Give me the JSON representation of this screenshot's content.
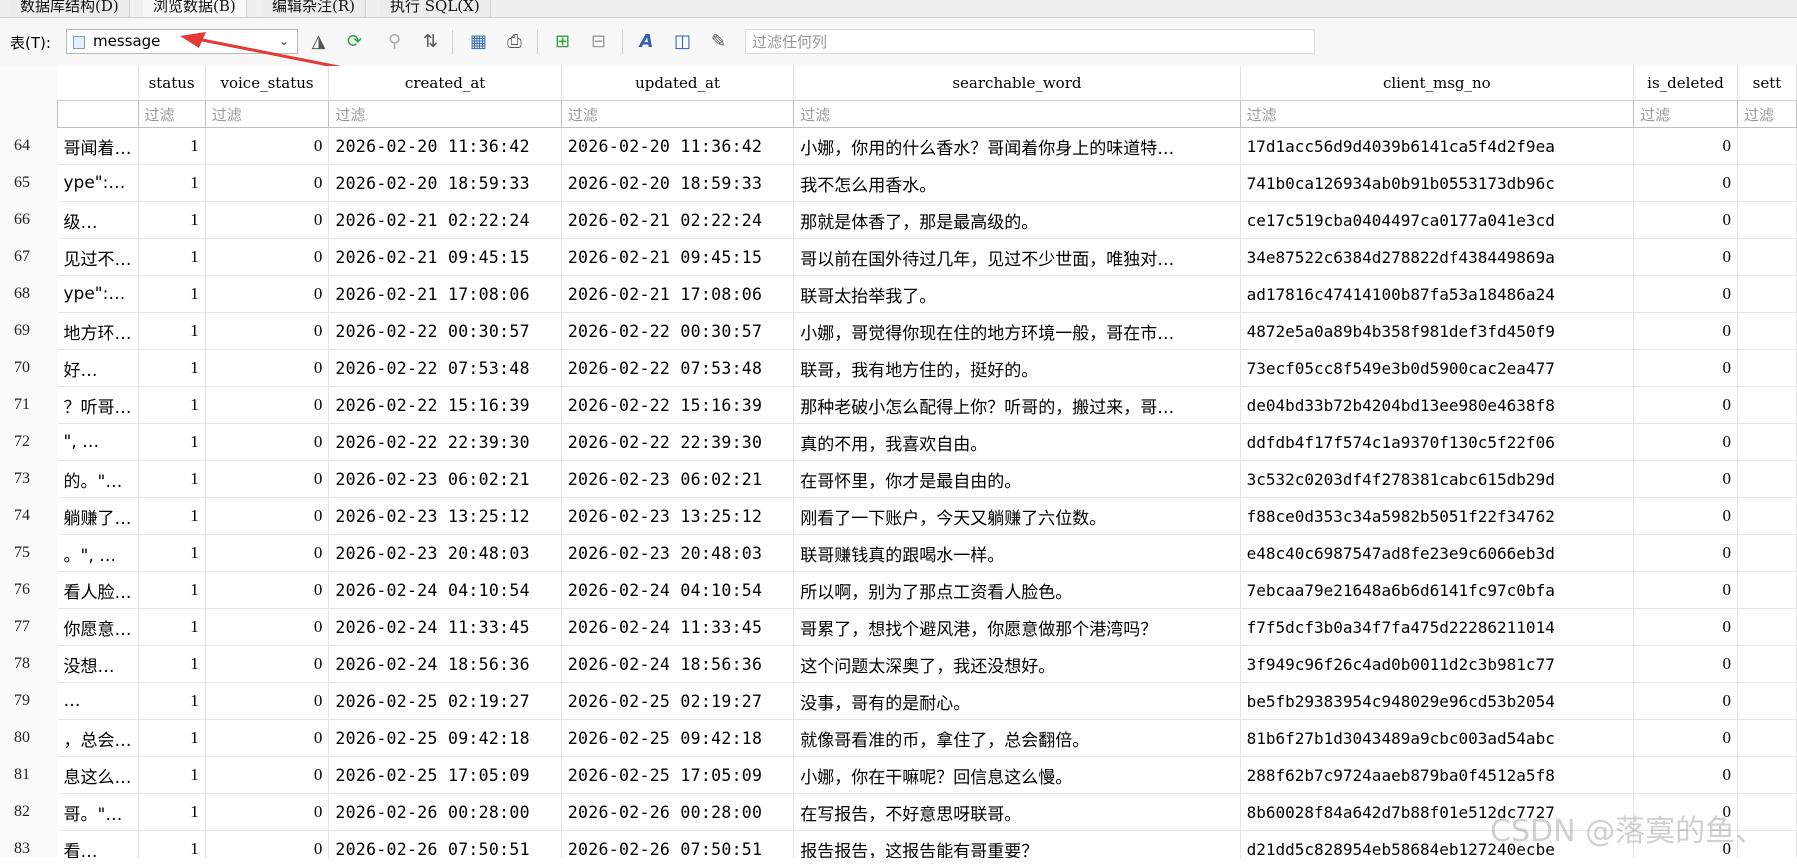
{
  "tabs": [
    "数据库结构(D)",
    "浏览数据(B)",
    "编辑杂注(R)",
    "执行 SQL(X)"
  ],
  "toolbar": {
    "table_label": "表(T):",
    "table_value": "message",
    "filter_placeholder": "过滤任何列"
  },
  "grid": {
    "columns": [
      "",
      "status",
      "voice_status",
      "created_at",
      "updated_at",
      "searchable_word",
      "client_msg_no",
      "is_deleted",
      "sett"
    ],
    "filter_placeholder": "过滤",
    "rows": [
      {
        "n": "64",
        "c0": "哥闻着…",
        "status": "1",
        "voice": "0",
        "created": "2026-02-20 11:36:42",
        "updated": "2026-02-20 11:36:42",
        "word": "小娜，你用的什么香水？哥闻着你身上的味道特…",
        "cmn": "17d1acc56d9d4039b6141ca5f4d2f9ea",
        "del": "0"
      },
      {
        "n": "65",
        "c0": "ype\":…",
        "status": "1",
        "voice": "0",
        "created": "2026-02-20 18:59:33",
        "updated": "2026-02-20 18:59:33",
        "word": "我不怎么用香水。",
        "cmn": "741b0ca126934ab0b91b0553173db96c",
        "del": "0"
      },
      {
        "n": "66",
        "c0": "级…",
        "status": "1",
        "voice": "0",
        "created": "2026-02-21 02:22:24",
        "updated": "2026-02-21 02:22:24",
        "word": "那就是体香了，那是最高级的。",
        "cmn": "ce17c519cba0404497ca0177a041e3cd",
        "del": "0"
      },
      {
        "n": "67",
        "c0": "见过不…",
        "status": "1",
        "voice": "0",
        "created": "2026-02-21 09:45:15",
        "updated": "2026-02-21 09:45:15",
        "word": "哥以前在国外待过几年，见过不少世面，唯独对…",
        "cmn": "34e87522c6384d278822df438449869a",
        "del": "0"
      },
      {
        "n": "68",
        "c0": "ype\":…",
        "status": "1",
        "voice": "0",
        "created": "2026-02-21 17:08:06",
        "updated": "2026-02-21 17:08:06",
        "word": "联哥太抬举我了。",
        "cmn": "ad17816c47414100b87fa53a18486a24",
        "del": "0"
      },
      {
        "n": "69",
        "c0": "地方环…",
        "status": "1",
        "voice": "0",
        "created": "2026-02-22 00:30:57",
        "updated": "2026-02-22 00:30:57",
        "word": "小娜，哥觉得你现在住的地方环境一般，哥在市…",
        "cmn": "4872e5a0a89b4b358f981def3fd450f9",
        "del": "0"
      },
      {
        "n": "70",
        "c0": "好…",
        "status": "1",
        "voice": "0",
        "created": "2026-02-22 07:53:48",
        "updated": "2026-02-22 07:53:48",
        "word": "联哥，我有地方住的，挺好的。",
        "cmn": "73ecf05cc8f549e3b0d5900cac2ea477",
        "del": "0"
      },
      {
        "n": "71",
        "c0": "？听哥…",
        "status": "1",
        "voice": "0",
        "created": "2026-02-22 15:16:39",
        "updated": "2026-02-22 15:16:39",
        "word": "那种老破小怎么配得上你？听哥的，搬过来，哥…",
        "cmn": "de04bd33b72b4204bd13ee980e4638f8",
        "del": "0"
      },
      {
        "n": "72",
        "c0": "\", …",
        "status": "1",
        "voice": "0",
        "created": "2026-02-22 22:39:30",
        "updated": "2026-02-22 22:39:30",
        "word": "真的不用，我喜欢自由。",
        "cmn": "ddfdb4f17f574c1a9370f130c5f22f06",
        "del": "0"
      },
      {
        "n": "73",
        "c0": "的。\"…",
        "status": "1",
        "voice": "0",
        "created": "2026-02-23 06:02:21",
        "updated": "2026-02-23 06:02:21",
        "word": "在哥怀里，你才是最自由的。",
        "cmn": "3c532c0203df4f278381cabc615db29d",
        "del": "0"
      },
      {
        "n": "74",
        "c0": "躺赚了…",
        "status": "1",
        "voice": "0",
        "created": "2026-02-23 13:25:12",
        "updated": "2026-02-23 13:25:12",
        "word": "刚看了一下账户，今天又躺赚了六位数。",
        "cmn": "f88ce0d353c34a5982b5051f22f34762",
        "del": "0"
      },
      {
        "n": "75",
        "c0": "。\", …",
        "status": "1",
        "voice": "0",
        "created": "2026-02-23 20:48:03",
        "updated": "2026-02-23 20:48:03",
        "word": "联哥赚钱真的跟喝水一样。",
        "cmn": "e48c40c6987547ad8fe23e9c6066eb3d",
        "del": "0"
      },
      {
        "n": "76",
        "c0": "看人脸…",
        "status": "1",
        "voice": "0",
        "created": "2026-02-24 04:10:54",
        "updated": "2026-02-24 04:10:54",
        "word": "所以啊，别为了那点工资看人脸色。",
        "cmn": "7ebcaa79e21648a6b6d6141fc97c0bfa",
        "del": "0"
      },
      {
        "n": "77",
        "c0": "你愿意…",
        "status": "1",
        "voice": "0",
        "created": "2026-02-24 11:33:45",
        "updated": "2026-02-24 11:33:45",
        "word": "哥累了，想找个避风港，你愿意做那个港湾吗？",
        "cmn": "f7f5dcf3b0a34f7fa475d22286211014",
        "del": "0"
      },
      {
        "n": "78",
        "c0": "没想…",
        "status": "1",
        "voice": "0",
        "created": "2026-02-24 18:56:36",
        "updated": "2026-02-24 18:56:36",
        "word": "这个问题太深奥了，我还没想好。",
        "cmn": "3f949c96f26c4ad0b0011d2c3b981c77",
        "del": "0"
      },
      {
        "n": "79",
        "c0": "…",
        "status": "1",
        "voice": "0",
        "created": "2026-02-25 02:19:27",
        "updated": "2026-02-25 02:19:27",
        "word": "没事，哥有的是耐心。",
        "cmn": "be5fb29383954c948029e96cd53b2054",
        "del": "0"
      },
      {
        "n": "80",
        "c0": "，总会…",
        "status": "1",
        "voice": "0",
        "created": "2026-02-25 09:42:18",
        "updated": "2026-02-25 09:42:18",
        "word": "就像哥看准的币，拿住了，总会翻倍。",
        "cmn": "81b6f27b1d3043489a9cbc003ad54abc",
        "del": "0"
      },
      {
        "n": "81",
        "c0": "息这么…",
        "status": "1",
        "voice": "0",
        "created": "2026-02-25 17:05:09",
        "updated": "2026-02-25 17:05:09",
        "word": "小娜，你在干嘛呢？回信息这么慢。",
        "cmn": "288f62b7c9724aaeb879ba0f4512a5f8",
        "del": "0"
      },
      {
        "n": "82",
        "c0": "哥。\"…",
        "status": "1",
        "voice": "0",
        "created": "2026-02-26 00:28:00",
        "updated": "2026-02-26 00:28:00",
        "word": "在写报告，不好意思呀联哥。",
        "cmn": "8b60028f84a642d7b88f01e512dc7727",
        "del": "0"
      },
      {
        "n": "83",
        "c0": "看…",
        "status": "1",
        "voice": "0",
        "created": "2026-02-26 07:50:51",
        "updated": "2026-02-26 07:50:51",
        "word": "报告报告，这报告能有哥重要？",
        "cmn": "d21dd5c828954eb58684eb127240ecbe",
        "del": "0"
      }
    ]
  },
  "watermark": "CSDN @落寞的鱼、"
}
